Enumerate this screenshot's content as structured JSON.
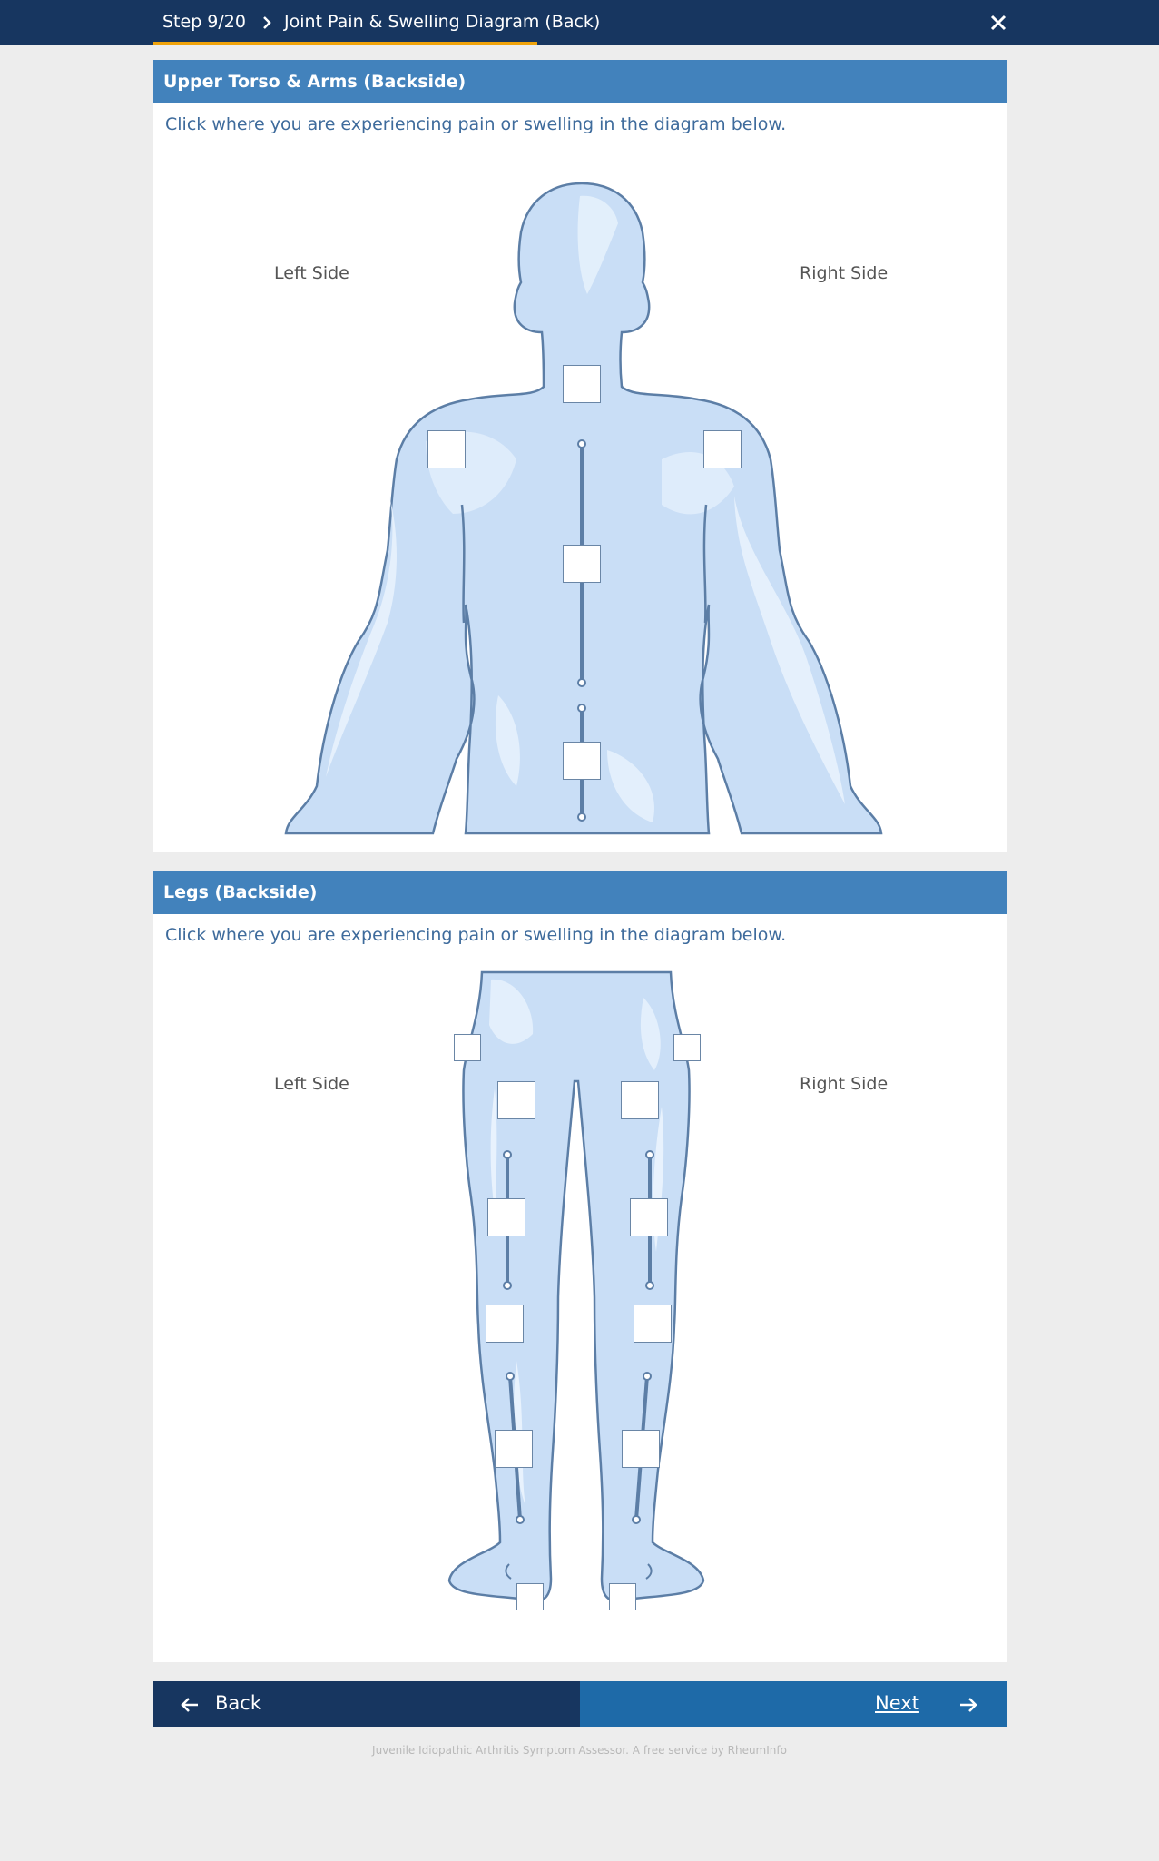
{
  "header": {
    "step": "Step 9/20",
    "title": "Joint Pain & Swelling Diagram (Back)",
    "close_icon": "close-icon",
    "chevron_icon": "chevron-right-icon"
  },
  "colors": {
    "header_bg": "#173660",
    "progress": "#f0a30a",
    "panel_head": "#4282bc",
    "body_fill": "#c9def6",
    "body_stroke": "#5c7ea6",
    "next_bg": "#1e6aa8"
  },
  "upper_panel": {
    "title": "Upper Torso & Arms (Backside)",
    "instruction": "Click where you are experiencing pain or swelling in the diagram below.",
    "left_label": "Left Side",
    "right_label": "Right Side"
  },
  "legs_panel": {
    "title": "Legs (Backside)",
    "instruction": "Click where you are experiencing pain or swelling in the diagram below.",
    "left_label": "Left Side",
    "right_label": "Right Side"
  },
  "nav": {
    "back_label": "Back",
    "next_label": "Next",
    "back_icon": "arrow-left-icon",
    "next_icon": "arrow-right-icon"
  },
  "footer": {
    "text": "Juvenile Idiopathic Arthritis Symptom Assessor. A free service by RheumInfo"
  }
}
